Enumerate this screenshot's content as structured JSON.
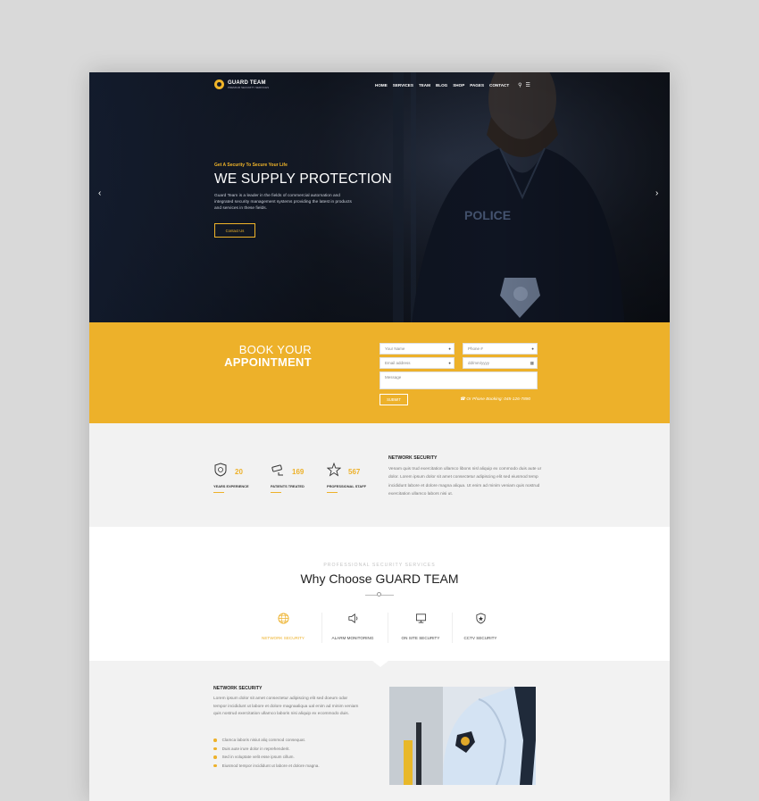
{
  "brand": {
    "name": "GUARD TEAM",
    "tagline": "PREMIUM SECURITY SERVICES"
  },
  "nav": {
    "items": [
      "HOME",
      "SERVICES",
      "TEAM",
      "BLOG",
      "SHOP",
      "PAGES",
      "CONTACT"
    ]
  },
  "hero": {
    "kicker": "Get A Security To Secure Your Life",
    "title": "WE SUPPLY PROTECTION",
    "body": "Guard Team is a leader in the fields of commercial automation and integrated security management systems providing the latest in products and services in these fields.",
    "button": "Contact Us"
  },
  "booking": {
    "title_line1": "BOOK YOUR",
    "title_line2": "APPOINTMENT",
    "name_placeholder": "Your Name",
    "phone_placeholder": "Phone #",
    "email_placeholder": "Email address",
    "date_placeholder": "dd/mm/yyyy",
    "message_placeholder": "Message",
    "submit": "SUBMIT",
    "phone_note": "Or Phone Booking: 045-126-7890"
  },
  "stats": [
    {
      "number": "20",
      "label": "YEARS EXPERIENCE"
    },
    {
      "number": "169",
      "label": "PATIENTS TREATED"
    },
    {
      "number": "567",
      "label": "PROFESSIONAL STAFF"
    }
  ],
  "network_security": {
    "heading": "NETWORK SECURITY",
    "text": "Venam quis trud exercitation ullamco libons nisl aliquip ex commodo duis aute ur dolor. Lorem ipsum dolor sit amet consectetur adipiscing elit sed eiusmod temp incididunt labore et dolore magna aliqua. Ut enim ad minim veniam quis nostrud exercitation ullamco labors nisi ut."
  },
  "why": {
    "kicker": "PROFESSIONAL SECURITY SERVICES",
    "title": "Why Choose GUARD TEAM",
    "tabs": [
      "NETWORK SECURITY",
      "ALARM MONITORING",
      "ON SITE SECURITY",
      "CCTV SECURITY"
    ]
  },
  "detail": {
    "heading": "NETWORK SECURITY",
    "text": "Lorem ipsum dolor sit amet consectetur adipiscing elit sed doeum odar tempor incididunt ut labore et dolore magnaaliqua ual enim ad minim veniam quis nostrud exercitation ullamco laboris nisi aliquip ex ecommodo duis.",
    "bullets": [
      "Clamca laboris nisiut aliq commod consequat.",
      "Duis aute irure dolor in reprehenderit.",
      "Sed in voluptate velit esse ipsum cillum.",
      "Eiusmod tempor incididunt ut labore et dolore magna."
    ]
  },
  "colors": {
    "accent": "#edb12a",
    "dark": "#161b26",
    "light_bg": "#f2f2f2"
  }
}
